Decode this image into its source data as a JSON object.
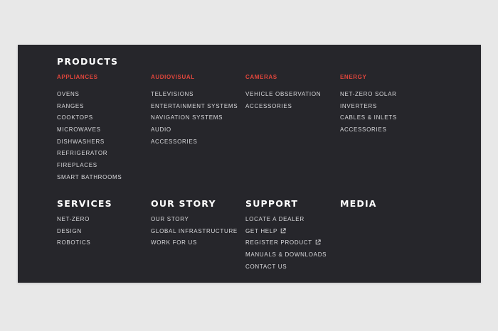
{
  "products": {
    "heading": "PRODUCTS",
    "categories": [
      {
        "title": "APPLIANCES",
        "items": [
          "OVENS",
          "RANGES",
          "COOKTOPS",
          "MICROWAVES",
          "DISHWASHERS",
          "REFRIGERATOR",
          "FIREPLACES",
          "SMART BATHROOMS"
        ]
      },
      {
        "title": "AUDIOVISUAL",
        "items": [
          "TELEVISIONS",
          "ENTERTAINMENT SYSTEMS",
          "NAVIGATION SYSTEMS",
          "AUDIO",
          "ACCESSORIES"
        ]
      },
      {
        "title": "CAMERAS",
        "items": [
          "VEHICLE OBSERVATION",
          "ACCESSORIES"
        ]
      },
      {
        "title": "ENERGY",
        "items": [
          "NET-ZERO SOLAR",
          "INVERTERS",
          "CABLES & INLETS",
          "ACCESSORIES"
        ]
      }
    ]
  },
  "services": {
    "heading": "SERVICES",
    "items": [
      "NET-ZERO",
      "DESIGN",
      "ROBOTICS"
    ]
  },
  "our_story": {
    "heading": "OUR STORY",
    "items": [
      "OUR STORY",
      "GLOBAL INFRASTRUCTURE",
      "WORK FOR US"
    ]
  },
  "support": {
    "heading": "SUPPORT",
    "items": [
      "LOCATE A DEALER",
      "GET HELP",
      "REGISTER PRODUCT",
      "MANUALS & DOWNLOADS",
      "CONTACT US"
    ]
  },
  "media": {
    "heading": "MEDIA"
  },
  "icons": {
    "external_link": "external-link-icon"
  },
  "colors": {
    "background": "#26262b",
    "accent": "#e0463c",
    "heading": "#ffffff",
    "link": "#d9d9dc"
  }
}
